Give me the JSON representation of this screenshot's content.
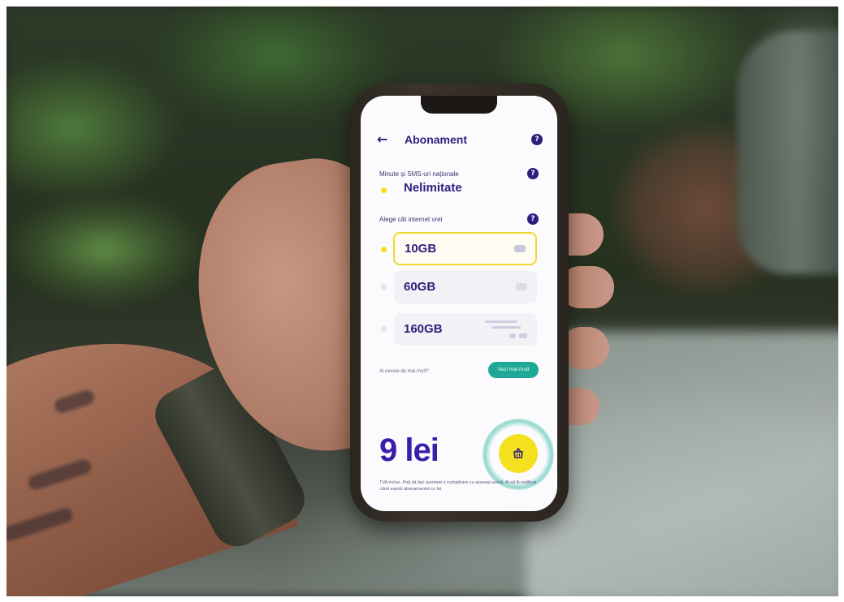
{
  "app": {
    "header": {
      "back_icon": "←",
      "title": "Abonament",
      "help_icon": "?"
    },
    "minutes": {
      "label": "Minute și SMS-uri naționale",
      "value": "Nelimitate",
      "help_icon": "?"
    },
    "internet": {
      "label": "Alege cât internet vrei",
      "help_icon": "?",
      "options": [
        {
          "label": "10GB",
          "selected": true
        },
        {
          "label": "60GB",
          "selected": false
        },
        {
          "label": "160GB",
          "selected": false
        }
      ]
    },
    "question": {
      "text": "Ai nevoie de mai mult?",
      "button": "Vezi mai mult"
    },
    "price": "9 lei",
    "cart_icon": "basket-icon",
    "legal": "TVA inclus. Poți să faci automat o cumpărare cu aceeași sumă. Ai să fii notificat când expiră abonamentul cu lei."
  },
  "colors": {
    "brand": "#2e1e7d",
    "accent_yellow": "#f4e01f",
    "cta_teal": "#20a896"
  }
}
